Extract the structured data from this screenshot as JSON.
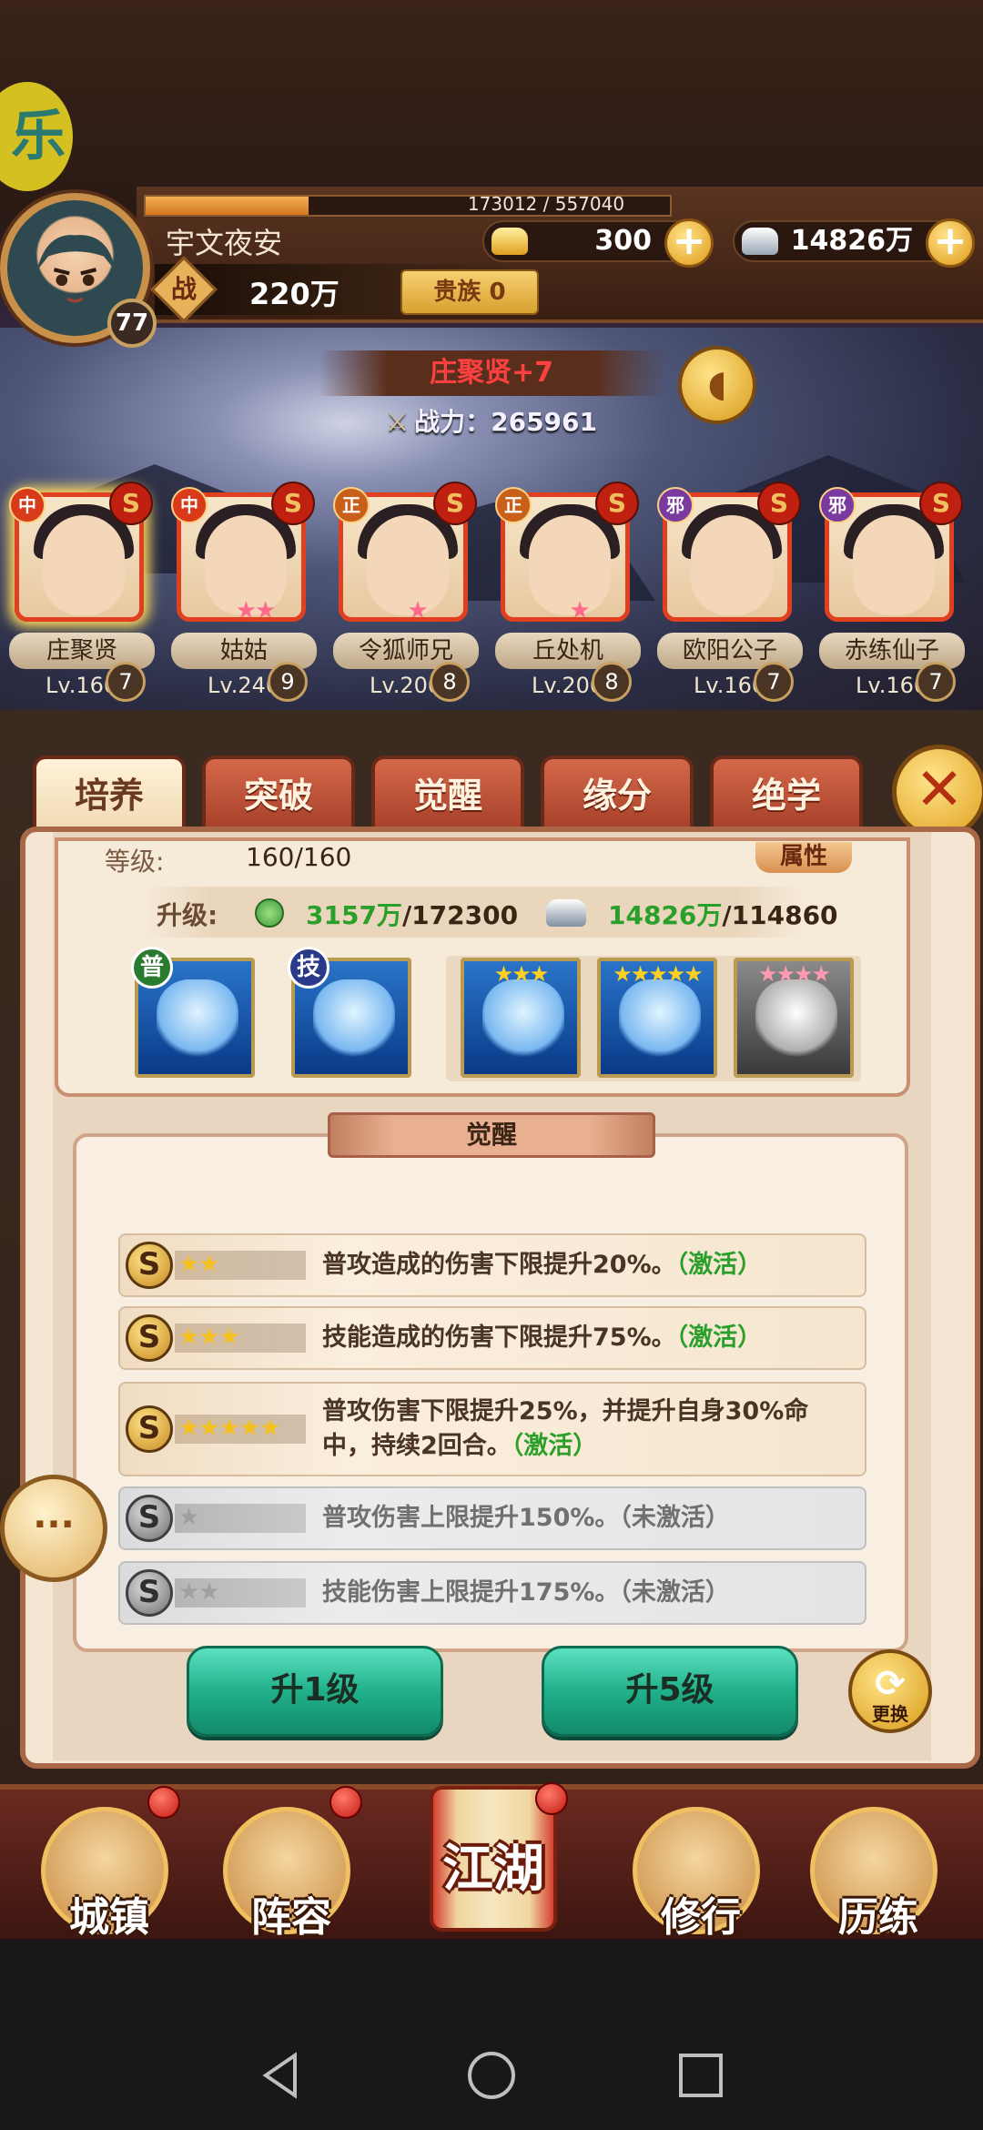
{
  "player": {
    "name": "宇文夜安",
    "level": "77",
    "exp_text": "173012 / 557040",
    "exp_ratio": 0.31,
    "combat_label": "战",
    "combat_value": "220万",
    "noble_label": "贵族 0",
    "gold": "300",
    "silver": "14826万"
  },
  "hero": {
    "title": "庄聚贤+7",
    "power_label": "战力：",
    "power_value": "265961"
  },
  "roster": [
    {
      "tag": "中",
      "tag_type": "mid",
      "stars": "",
      "name": "庄聚贤",
      "lv": "Lv.160",
      "star_count": "7",
      "selected": true
    },
    {
      "tag": "中",
      "tag_type": "mid",
      "stars": "★★",
      "name": "姑姑",
      "lv": "Lv.240",
      "star_count": "9",
      "selected": false
    },
    {
      "tag": "正",
      "tag_type": "good",
      "stars": "★",
      "name": "令狐师兄",
      "lv": "Lv.200",
      "star_count": "8",
      "selected": false
    },
    {
      "tag": "正",
      "tag_type": "good",
      "stars": "★",
      "name": "丘处机",
      "lv": "Lv.200",
      "star_count": "8",
      "selected": false
    },
    {
      "tag": "邪",
      "tag_type": "evil",
      "stars": "",
      "name": "欧阳公子",
      "lv": "Lv.160",
      "star_count": "7",
      "selected": false
    },
    {
      "tag": "邪",
      "tag_type": "evil",
      "stars": "",
      "name": "赤练仙子",
      "lv": "Lv.160",
      "star_count": "7",
      "selected": false
    }
  ],
  "tabs": [
    "培养",
    "突破",
    "觉醒",
    "缘分",
    "绝学"
  ],
  "active_tab": 0,
  "cultivate": {
    "level_label": "等级:",
    "level_value": "160/160",
    "attr_button": "属性",
    "upgrade_label": "升级:",
    "exp_have": "3157万",
    "exp_need": "/172300",
    "silver_have": "14826万",
    "silver_need": "/114860",
    "exp_icon_text": "经验",
    "slots": [
      {
        "tag": "普",
        "stars": "",
        "grey": false
      },
      {
        "tag": "技",
        "stars": "",
        "grey": false
      },
      {
        "tag": "",
        "stars": "★★★",
        "grey": false
      },
      {
        "tag": "",
        "stars": "★★★★★",
        "grey": false
      },
      {
        "tag": "",
        "stars": "★★★★",
        "grey": true
      }
    ]
  },
  "awaken": {
    "title": "觉醒",
    "skills": [
      {
        "stars": "★★",
        "text": "普攻造成的伤害下限提升20%。",
        "status": "（激活）",
        "active": true
      },
      {
        "stars": "★★★",
        "text": "技能造成的伤害下限提升75%。",
        "status": "（激活）",
        "active": true
      },
      {
        "stars": "★★★★★",
        "text": "普攻伤害下限提升25%，并提升自身30%命中，持续2回合。",
        "status": "（激活）",
        "active": true
      },
      {
        "stars": "★",
        "text": "普攻伤害上限提升150%。",
        "status": "（未激活）",
        "active": false
      },
      {
        "stars": "★★",
        "text": "技能伤害上限提升175%。",
        "status": "（未激活）",
        "active": false
      }
    ]
  },
  "buttons": {
    "up1": "升1级",
    "up5": "升5级",
    "swap": "更换"
  },
  "nav": [
    "城镇",
    "阵容",
    "江湖",
    "修行",
    "历练"
  ],
  "colors": {
    "accent_green": "#2aa02a",
    "tab_red": "#a23c26",
    "button_green": "#20b08a"
  }
}
